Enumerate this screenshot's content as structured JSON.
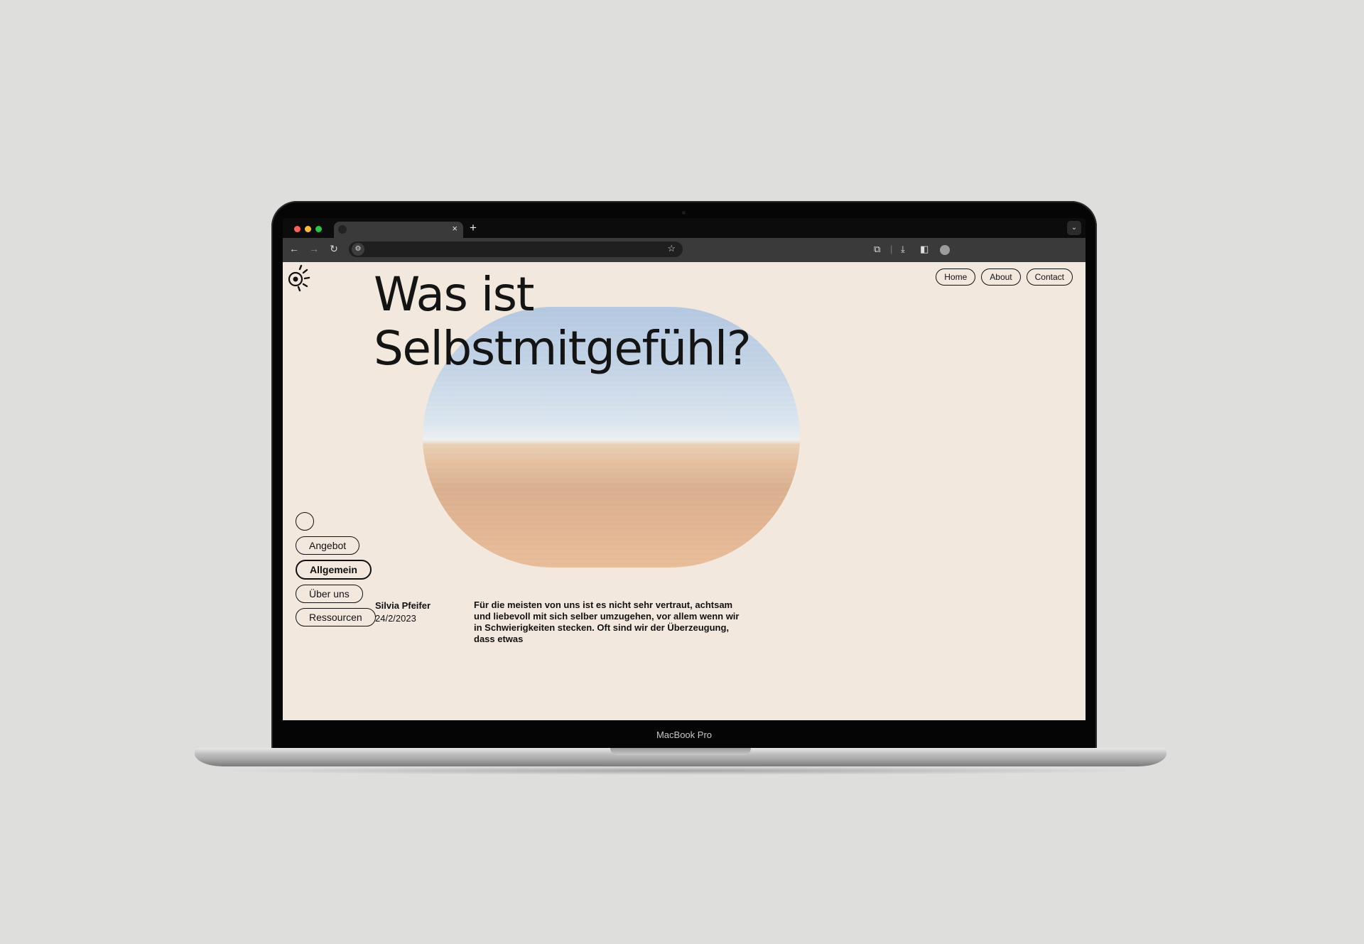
{
  "browser": {
    "tab_close": "×",
    "new_tab": "+",
    "tab_menu": "⌄",
    "toolbar_icons": [
      "back-icon",
      "forward-icon",
      "reload-icon",
      "tune-icon",
      "star-icon",
      "extensions-icon",
      "download-icon",
      "sidepanel-icon",
      "profile-icon"
    ]
  },
  "site": {
    "nav": {
      "home": "Home",
      "about": "About",
      "contact": "Contact"
    },
    "headline_line1": "Was ist",
    "headline_line2": "Selbstmitgefühl?",
    "side_nav": {
      "item1": "Angebot",
      "item2": "Allgemein",
      "item3": "Über uns",
      "item4": "Ressourcen",
      "active": "Allgemein"
    },
    "author": {
      "name": "Silvia Pfeifer",
      "date": "24/2/2023"
    },
    "article_text": "Für die meisten von uns ist es nicht sehr vertraut, achtsam und liebevoll mit sich selber umzugehen, vor allem wenn wir in Schwierigkeiten stecken. Oft sind wir der Überzeugung, dass etwas"
  },
  "device": {
    "label": "MacBook Pro"
  },
  "colors": {
    "page_background": "#f3e8de",
    "text": "#141414",
    "backdrop": "#dededd"
  }
}
